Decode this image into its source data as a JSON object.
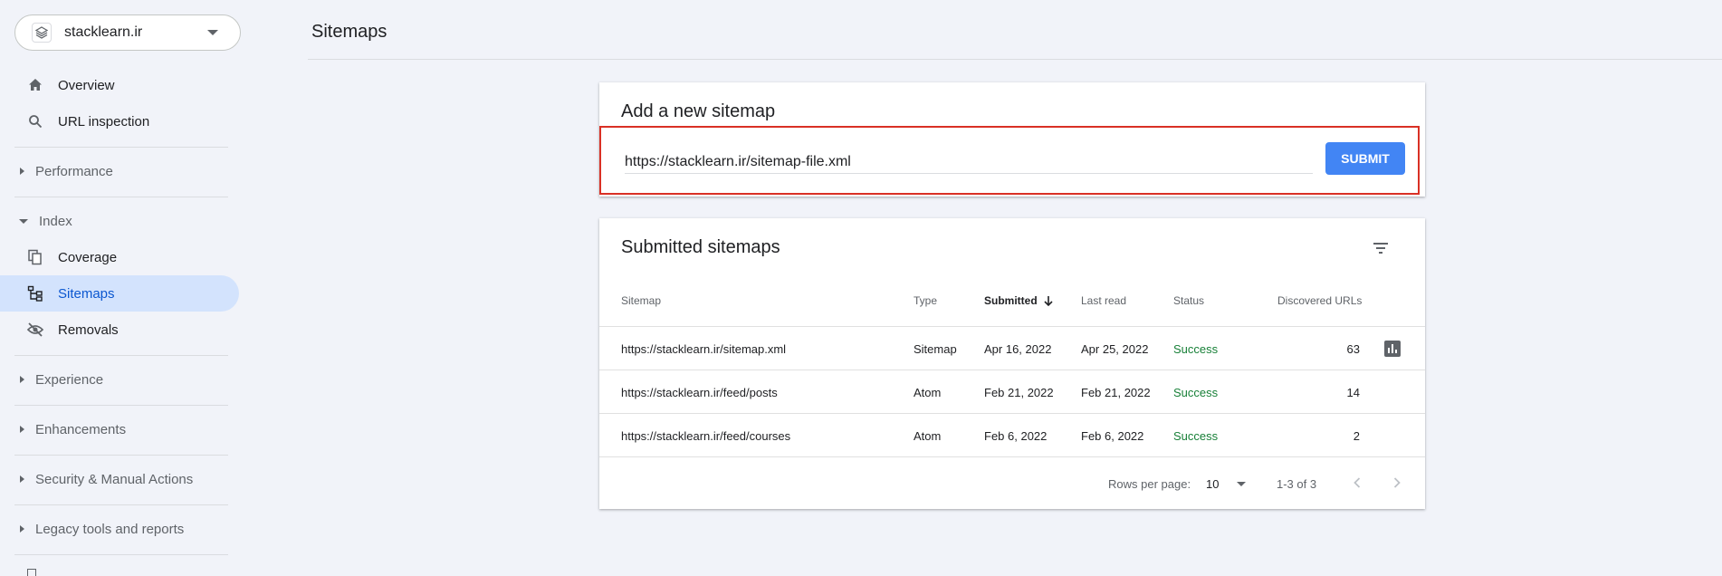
{
  "property": {
    "name": "stacklearn.ir",
    "icon": "layers-icon"
  },
  "nav": {
    "overview": "Overview",
    "url_inspection": "URL inspection",
    "performance": "Performance",
    "index": "Index",
    "coverage": "Coverage",
    "sitemaps": "Sitemaps",
    "removals": "Removals",
    "experience": "Experience",
    "enhancements": "Enhancements",
    "security": "Security & Manual Actions",
    "legacy": "Legacy tools and reports"
  },
  "header": {
    "title": "Sitemaps"
  },
  "add_sitemap": {
    "title": "Add a new sitemap",
    "input_value": "https://stacklearn.ir/sitemap-file.xml",
    "submit_label": "SUBMIT"
  },
  "submitted": {
    "title": "Submitted sitemaps",
    "columns": {
      "sitemap": "Sitemap",
      "type": "Type",
      "submitted": "Submitted",
      "last_read": "Last read",
      "status": "Status",
      "discovered": "Discovered URLs"
    },
    "rows": [
      {
        "sitemap": "https://stacklearn.ir/sitemap.xml",
        "type": "Sitemap",
        "submitted": "Apr 16, 2022",
        "last_read": "Apr 25, 2022",
        "status": "Success",
        "discovered": "63"
      },
      {
        "sitemap": "https://stacklearn.ir/feed/posts",
        "type": "Atom",
        "submitted": "Feb 21, 2022",
        "last_read": "Feb 21, 2022",
        "status": "Success",
        "discovered": "14"
      },
      {
        "sitemap": "https://stacklearn.ir/feed/courses",
        "type": "Atom",
        "submitted": "Feb 6, 2022",
        "last_read": "Feb 6, 2022",
        "status": "Success",
        "discovered": "2"
      }
    ],
    "rows_per_page_label": "Rows per page:",
    "rows_per_page_value": "10",
    "range": "1-3 of 3"
  },
  "colors": {
    "accent": "#4285f4",
    "success": "#188038",
    "active_nav": "#d3e3fd",
    "highlight_border": "#d93025"
  }
}
